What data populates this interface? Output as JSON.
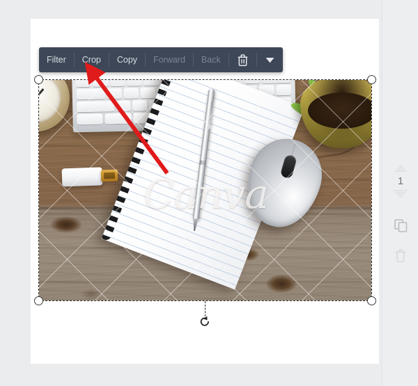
{
  "app": {
    "background_color": "#ebecee",
    "canvas_color": "#ffffff"
  },
  "toolbar": {
    "name": "element-toolbar",
    "background_color": "#3d4757",
    "text_color": "#d9dde3",
    "disabled_text_color": "#7b8494",
    "items": [
      {
        "label": "Filter",
        "enabled": true,
        "name": "filter-button"
      },
      {
        "label": "Crop",
        "enabled": true,
        "name": "crop-button"
      },
      {
        "label": "Copy",
        "enabled": true,
        "name": "copy-button"
      },
      {
        "label": "Forward",
        "enabled": false,
        "name": "forward-button"
      },
      {
        "label": "Back",
        "enabled": false,
        "name": "back-button"
      }
    ],
    "icons": [
      {
        "name": "trash-icon",
        "label": "Delete"
      },
      {
        "name": "chevron-down-icon",
        "label": "More options"
      }
    ]
  },
  "selection": {
    "name": "image-element-selection",
    "handles": [
      "top-left",
      "top-right",
      "bottom-left",
      "bottom-right"
    ],
    "rotate_handle": "rotate-handle",
    "border_style": "dashed"
  },
  "right_rail": {
    "layer_value": "1",
    "controls": [
      {
        "name": "layer-up-arrow",
        "label": "Bring forward"
      },
      {
        "name": "layer-number",
        "label": "1"
      },
      {
        "name": "layer-down-arrow",
        "label": "Send backward"
      },
      {
        "name": "duplicate-icon",
        "label": "Duplicate"
      },
      {
        "name": "delete-icon",
        "label": "Delete"
      }
    ]
  },
  "image": {
    "name": "desk-photo",
    "watermark_text": "Canva",
    "watermark_pattern": "diagonal-crosshatch",
    "description_objects": [
      "wooden-desk",
      "keyboard",
      "spiral-notepad",
      "pen",
      "computer-mouse",
      "usb-flash-drive",
      "alarm-clock",
      "potted-plant"
    ]
  },
  "annotation": {
    "name": "red-arrow",
    "color": "#e01b1b",
    "points_to": "Crop"
  }
}
